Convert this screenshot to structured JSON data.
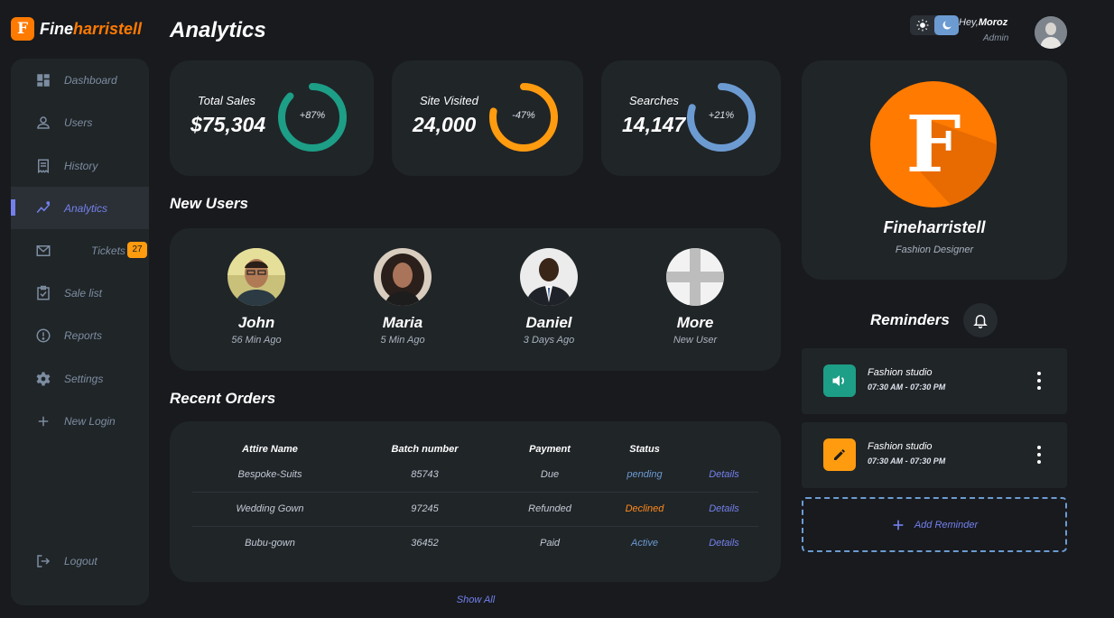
{
  "brand": {
    "initial": "F",
    "name_part1": "Fine",
    "name_part2": "harristell"
  },
  "sidebar": {
    "items": [
      {
        "label": "Dashboard",
        "icon": "dashboard-icon"
      },
      {
        "label": "Users",
        "icon": "person-icon"
      },
      {
        "label": "History",
        "icon": "receipt-icon"
      },
      {
        "label": "Analytics",
        "icon": "insights-icon",
        "active": true
      },
      {
        "label": "Tickets",
        "icon": "mail-icon",
        "badge": "27"
      },
      {
        "label": "Sale list",
        "icon": "clipboard-check-icon"
      },
      {
        "label": "Reports",
        "icon": "report-icon"
      },
      {
        "label": "Settings",
        "icon": "gear-icon"
      },
      {
        "label": "New Login",
        "icon": "plus-icon"
      }
    ],
    "logout": {
      "label": "Logout",
      "icon": "logout-icon"
    }
  },
  "header": {
    "title": "Analytics",
    "greeting_prefix": "Hey,",
    "user_name": "Moroz",
    "user_role": "Admin",
    "theme_icons": [
      "sun-icon",
      "moon-icon"
    ]
  },
  "stats": [
    {
      "label": "Total Sales",
      "value": "$75,304",
      "percent_label": "+87%",
      "progress": 0.87,
      "color": "#1d9e86"
    },
    {
      "label": "Site Visited",
      "value": "24,000",
      "percent_label": "-47%",
      "progress": 0.78,
      "color": "#ff9b0f"
    },
    {
      "label": "Searches",
      "value": "14,147",
      "percent_label": "+21%",
      "progress": 0.8,
      "color": "#6c9bd2"
    }
  ],
  "new_users": {
    "title": "New Users",
    "users": [
      {
        "name": "John",
        "time": "56 Min Ago"
      },
      {
        "name": "Maria",
        "time": "5 Min Ago"
      },
      {
        "name": "Daniel",
        "time": "3 Days Ago"
      },
      {
        "name": "More",
        "time": "New User"
      }
    ]
  },
  "orders": {
    "title": "Recent Orders",
    "columns": [
      "Attire Name",
      "Batch number",
      "Payment",
      "Status"
    ],
    "rows": [
      {
        "name": "Bespoke-Suits",
        "batch": "85743",
        "payment": "Due",
        "status": "pending",
        "status_color": "#6c9bd2",
        "action": "Details"
      },
      {
        "name": "Wedding Gown",
        "batch": "97245",
        "payment": "Refunded",
        "status": "Declined",
        "status_color": "#ff8a1d",
        "action": "Details"
      },
      {
        "name": "Bubu-gown",
        "batch": "36452",
        "payment": "Paid",
        "status": "Active",
        "status_color": "#6c9bd2",
        "action": "Details"
      }
    ],
    "show_all": "Show All"
  },
  "profile": {
    "initial": "F",
    "name": "Fineharristell",
    "role": "Fashion Designer",
    "logo_color": "#ff7a00"
  },
  "reminders": {
    "title": "Reminders",
    "items": [
      {
        "title": "Fashion studio",
        "time": "07:30 AM - 07:30 PM",
        "icon": "volume-icon",
        "color": "#1d9e86"
      },
      {
        "title": "Fashion studio",
        "time": "07:30 AM - 07:30 PM",
        "icon": "pencil-icon",
        "color": "#ff9b0f"
      }
    ],
    "add_label": "Add Reminder"
  },
  "colors": {
    "background": "#181a1e",
    "card": "#202528",
    "accent": "#7380ec"
  }
}
